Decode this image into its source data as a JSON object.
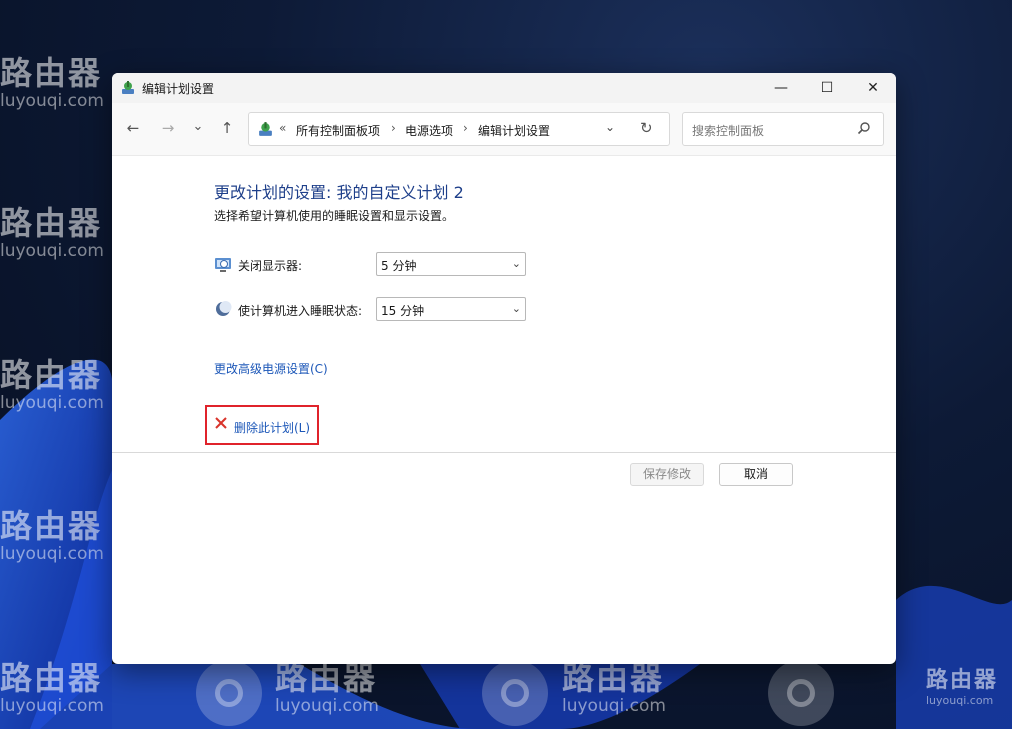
{
  "watermark": {
    "brand": "路由器",
    "domain": "luyouqi.com",
    "corner_brand": "路由器",
    "corner_domain": "luyouqi.com"
  },
  "window": {
    "title": "编辑计划设置",
    "controls": {
      "minimize": "—",
      "maximize": "☐",
      "close": "✕"
    }
  },
  "nav": {
    "back": "←",
    "forward": "→",
    "recent": "⌄",
    "up": "↑",
    "overflow": "«",
    "breadcrumbs": [
      "所有控制面板项",
      "电源选项",
      "编辑计划设置"
    ],
    "separator": "›",
    "dropdown": "⌄",
    "refresh": "↻",
    "search_placeholder": "搜索控制面板"
  },
  "content": {
    "heading": "更改计划的设置: 我的自定义计划 2",
    "subtext": "选择希望计算机使用的睡眠设置和显示设置。",
    "settings": [
      {
        "label": "关闭显示器:",
        "value": "5 分钟",
        "icon": "monitor-icon"
      },
      {
        "label": "使计算机进入睡眠状态:",
        "value": "15 分钟",
        "icon": "moon-icon"
      }
    ],
    "select_arrow": "⌄",
    "advanced_link": "更改高级电源设置(C)",
    "delete_link": "删除此计划(L)"
  },
  "footer": {
    "save_label": "保存修改",
    "cancel_label": "取消"
  },
  "colors": {
    "heading": "#1e3f8a",
    "link": "#1c57b8",
    "highlight_border": "#e0232b"
  }
}
